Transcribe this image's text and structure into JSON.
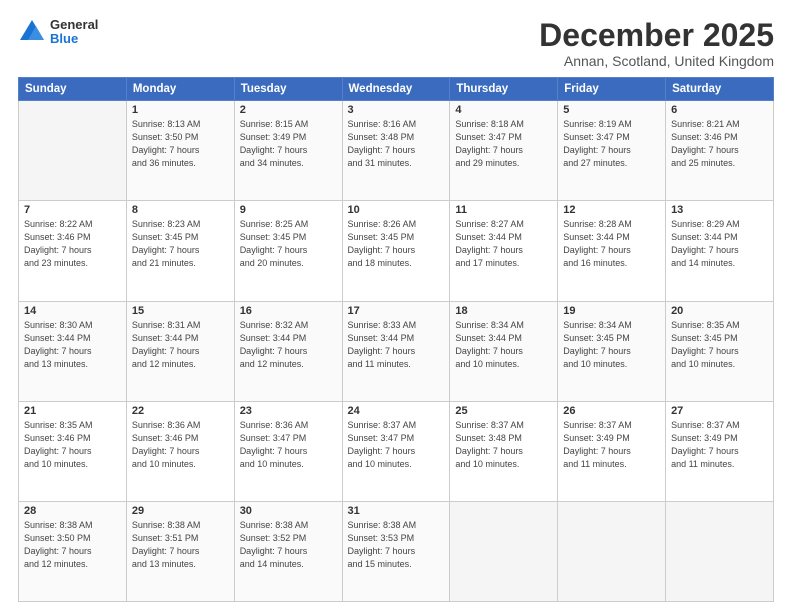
{
  "logo": {
    "general": "General",
    "blue": "Blue"
  },
  "header": {
    "month": "December 2025",
    "location": "Annan, Scotland, United Kingdom"
  },
  "weekdays": [
    "Sunday",
    "Monday",
    "Tuesday",
    "Wednesday",
    "Thursday",
    "Friday",
    "Saturday"
  ],
  "weeks": [
    [
      {
        "day": "",
        "empty": true
      },
      {
        "day": "1",
        "sunrise": "Sunrise: 8:13 AM",
        "sunset": "Sunset: 3:50 PM",
        "daylight": "Daylight: 7 hours and 36 minutes."
      },
      {
        "day": "2",
        "sunrise": "Sunrise: 8:15 AM",
        "sunset": "Sunset: 3:49 PM",
        "daylight": "Daylight: 7 hours and 34 minutes."
      },
      {
        "day": "3",
        "sunrise": "Sunrise: 8:16 AM",
        "sunset": "Sunset: 3:48 PM",
        "daylight": "Daylight: 7 hours and 31 minutes."
      },
      {
        "day": "4",
        "sunrise": "Sunrise: 8:18 AM",
        "sunset": "Sunset: 3:47 PM",
        "daylight": "Daylight: 7 hours and 29 minutes."
      },
      {
        "day": "5",
        "sunrise": "Sunrise: 8:19 AM",
        "sunset": "Sunset: 3:47 PM",
        "daylight": "Daylight: 7 hours and 27 minutes."
      },
      {
        "day": "6",
        "sunrise": "Sunrise: 8:21 AM",
        "sunset": "Sunset: 3:46 PM",
        "daylight": "Daylight: 7 hours and 25 minutes."
      }
    ],
    [
      {
        "day": "7",
        "sunrise": "Sunrise: 8:22 AM",
        "sunset": "Sunset: 3:46 PM",
        "daylight": "Daylight: 7 hours and 23 minutes."
      },
      {
        "day": "8",
        "sunrise": "Sunrise: 8:23 AM",
        "sunset": "Sunset: 3:45 PM",
        "daylight": "Daylight: 7 hours and 21 minutes."
      },
      {
        "day": "9",
        "sunrise": "Sunrise: 8:25 AM",
        "sunset": "Sunset: 3:45 PM",
        "daylight": "Daylight: 7 hours and 20 minutes."
      },
      {
        "day": "10",
        "sunrise": "Sunrise: 8:26 AM",
        "sunset": "Sunset: 3:45 PM",
        "daylight": "Daylight: 7 hours and 18 minutes."
      },
      {
        "day": "11",
        "sunrise": "Sunrise: 8:27 AM",
        "sunset": "Sunset: 3:44 PM",
        "daylight": "Daylight: 7 hours and 17 minutes."
      },
      {
        "day": "12",
        "sunrise": "Sunrise: 8:28 AM",
        "sunset": "Sunset: 3:44 PM",
        "daylight": "Daylight: 7 hours and 16 minutes."
      },
      {
        "day": "13",
        "sunrise": "Sunrise: 8:29 AM",
        "sunset": "Sunset: 3:44 PM",
        "daylight": "Daylight: 7 hours and 14 minutes."
      }
    ],
    [
      {
        "day": "14",
        "sunrise": "Sunrise: 8:30 AM",
        "sunset": "Sunset: 3:44 PM",
        "daylight": "Daylight: 7 hours and 13 minutes."
      },
      {
        "day": "15",
        "sunrise": "Sunrise: 8:31 AM",
        "sunset": "Sunset: 3:44 PM",
        "daylight": "Daylight: 7 hours and 12 minutes."
      },
      {
        "day": "16",
        "sunrise": "Sunrise: 8:32 AM",
        "sunset": "Sunset: 3:44 PM",
        "daylight": "Daylight: 7 hours and 12 minutes."
      },
      {
        "day": "17",
        "sunrise": "Sunrise: 8:33 AM",
        "sunset": "Sunset: 3:44 PM",
        "daylight": "Daylight: 7 hours and 11 minutes."
      },
      {
        "day": "18",
        "sunrise": "Sunrise: 8:34 AM",
        "sunset": "Sunset: 3:44 PM",
        "daylight": "Daylight: 7 hours and 10 minutes."
      },
      {
        "day": "19",
        "sunrise": "Sunrise: 8:34 AM",
        "sunset": "Sunset: 3:45 PM",
        "daylight": "Daylight: 7 hours and 10 minutes."
      },
      {
        "day": "20",
        "sunrise": "Sunrise: 8:35 AM",
        "sunset": "Sunset: 3:45 PM",
        "daylight": "Daylight: 7 hours and 10 minutes."
      }
    ],
    [
      {
        "day": "21",
        "sunrise": "Sunrise: 8:35 AM",
        "sunset": "Sunset: 3:46 PM",
        "daylight": "Daylight: 7 hours and 10 minutes."
      },
      {
        "day": "22",
        "sunrise": "Sunrise: 8:36 AM",
        "sunset": "Sunset: 3:46 PM",
        "daylight": "Daylight: 7 hours and 10 minutes."
      },
      {
        "day": "23",
        "sunrise": "Sunrise: 8:36 AM",
        "sunset": "Sunset: 3:47 PM",
        "daylight": "Daylight: 7 hours and 10 minutes."
      },
      {
        "day": "24",
        "sunrise": "Sunrise: 8:37 AM",
        "sunset": "Sunset: 3:47 PM",
        "daylight": "Daylight: 7 hours and 10 minutes."
      },
      {
        "day": "25",
        "sunrise": "Sunrise: 8:37 AM",
        "sunset": "Sunset: 3:48 PM",
        "daylight": "Daylight: 7 hours and 10 minutes."
      },
      {
        "day": "26",
        "sunrise": "Sunrise: 8:37 AM",
        "sunset": "Sunset: 3:49 PM",
        "daylight": "Daylight: 7 hours and 11 minutes."
      },
      {
        "day": "27",
        "sunrise": "Sunrise: 8:37 AM",
        "sunset": "Sunset: 3:49 PM",
        "daylight": "Daylight: 7 hours and 11 minutes."
      }
    ],
    [
      {
        "day": "28",
        "sunrise": "Sunrise: 8:38 AM",
        "sunset": "Sunset: 3:50 PM",
        "daylight": "Daylight: 7 hours and 12 minutes."
      },
      {
        "day": "29",
        "sunrise": "Sunrise: 8:38 AM",
        "sunset": "Sunset: 3:51 PM",
        "daylight": "Daylight: 7 hours and 13 minutes."
      },
      {
        "day": "30",
        "sunrise": "Sunrise: 8:38 AM",
        "sunset": "Sunset: 3:52 PM",
        "daylight": "Daylight: 7 hours and 14 minutes."
      },
      {
        "day": "31",
        "sunrise": "Sunrise: 8:38 AM",
        "sunset": "Sunset: 3:53 PM",
        "daylight": "Daylight: 7 hours and 15 minutes."
      },
      {
        "day": "",
        "empty": true
      },
      {
        "day": "",
        "empty": true
      },
      {
        "day": "",
        "empty": true
      }
    ]
  ]
}
